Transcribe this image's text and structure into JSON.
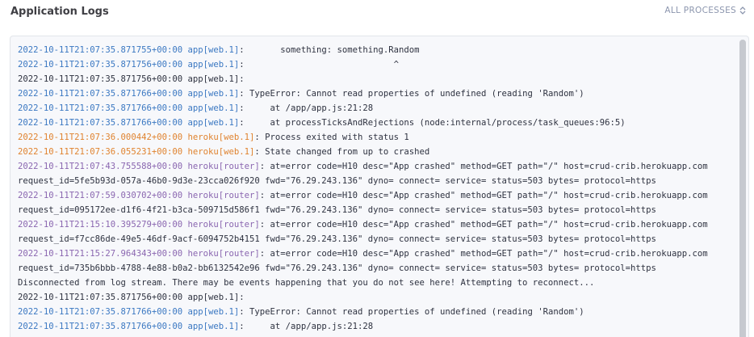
{
  "header": {
    "title": "Application Logs",
    "process_filter": "ALL PROCESSES"
  },
  "log": {
    "lines": [
      {
        "kind": "app",
        "ts": "2022-10-11T21:07:35.871755+00:00",
        "src": "app[web.1]",
        "msg": ":       something: something.Random"
      },
      {
        "kind": "app",
        "ts": "2022-10-11T21:07:35.871756+00:00",
        "src": "app[web.1]",
        "msg": ":                             ^"
      },
      {
        "kind": "plain",
        "text": "2022-10-11T21:07:35.871756+00:00 app[web.1]:"
      },
      {
        "kind": "app",
        "ts": "2022-10-11T21:07:35.871766+00:00",
        "src": "app[web.1]",
        "msg": ": TypeError: Cannot read properties of undefined (reading 'Random')"
      },
      {
        "kind": "app",
        "ts": "2022-10-11T21:07:35.871766+00:00",
        "src": "app[web.1]",
        "msg": ":     at /app/app.js:21:28"
      },
      {
        "kind": "app",
        "ts": "2022-10-11T21:07:35.871766+00:00",
        "src": "app[web.1]",
        "msg": ":     at processTicksAndRejections (node:internal/process/task_queues:96:5)"
      },
      {
        "kind": "heroku",
        "ts": "2022-10-11T21:07:36.000442+00:00",
        "src": "heroku[web.1]",
        "msg": ": Process exited with status 1"
      },
      {
        "kind": "heroku",
        "ts": "2022-10-11T21:07:36.055231+00:00",
        "src": "heroku[web.1]",
        "msg": ": State changed from up to crashed"
      },
      {
        "kind": "router",
        "ts": "2022-10-11T21:07:43.755588+00:00",
        "src": "heroku[router]",
        "msg": ": at=error code=H10 desc=\"App crashed\" method=GET path=\"/\" host=crud-crib.herokuapp.com"
      },
      {
        "kind": "plain",
        "text": "request_id=5fe5b93d-057a-46b0-9d3e-23cca026f920 fwd=\"76.29.243.136\" dyno= connect= service= status=503 bytes= protocol=https"
      },
      {
        "kind": "router",
        "ts": "2022-10-11T21:07:59.030702+00:00",
        "src": "heroku[router]",
        "msg": ": at=error code=H10 desc=\"App crashed\" method=GET path=\"/\" host=crud-crib.herokuapp.com"
      },
      {
        "kind": "plain",
        "text": "request_id=095172ee-d1f6-4f21-b3ca-509715d586f1 fwd=\"76.29.243.136\" dyno= connect= service= status=503 bytes= protocol=https"
      },
      {
        "kind": "router",
        "ts": "2022-10-11T21:15:10.395279+00:00",
        "src": "heroku[router]",
        "msg": ": at=error code=H10 desc=\"App crashed\" method=GET path=\"/\" host=crud-crib.herokuapp.com"
      },
      {
        "kind": "plain",
        "text": "request_id=f7cc86de-49e5-46df-9acf-6094752b4151 fwd=\"76.29.243.136\" dyno= connect= service= status=503 bytes= protocol=https"
      },
      {
        "kind": "router",
        "ts": "2022-10-11T21:15:27.964343+00:00",
        "src": "heroku[router]",
        "msg": ": at=error code=H10 desc=\"App crashed\" method=GET path=\"/\" host=crud-crib.herokuapp.com"
      },
      {
        "kind": "plain",
        "text": "request_id=735b6bbb-4788-4e88-b0a2-bb6132542e96 fwd=\"76.29.243.136\" dyno= connect= service= status=503 bytes= protocol=https"
      },
      {
        "kind": "plain",
        "text": "Disconnected from log stream. There may be events happening that you do not see here! Attempting to reconnect..."
      },
      {
        "kind": "plain",
        "text": "2022-10-11T21:07:35.871756+00:00 app[web.1]:"
      },
      {
        "kind": "app",
        "ts": "2022-10-11T21:07:35.871766+00:00",
        "src": "app[web.1]",
        "msg": ": TypeError: Cannot read properties of undefined (reading 'Random')"
      },
      {
        "kind": "app",
        "ts": "2022-10-11T21:07:35.871766+00:00",
        "src": "app[web.1]",
        "msg": ":     at /app/app.js:21:28"
      }
    ]
  },
  "colors": {
    "app": "#3b78c2",
    "heroku": "#e0832f",
    "router": "#8a66b0",
    "text": "#2e3240"
  },
  "icons": {
    "process_filter": "chevron-up-down-icon"
  }
}
